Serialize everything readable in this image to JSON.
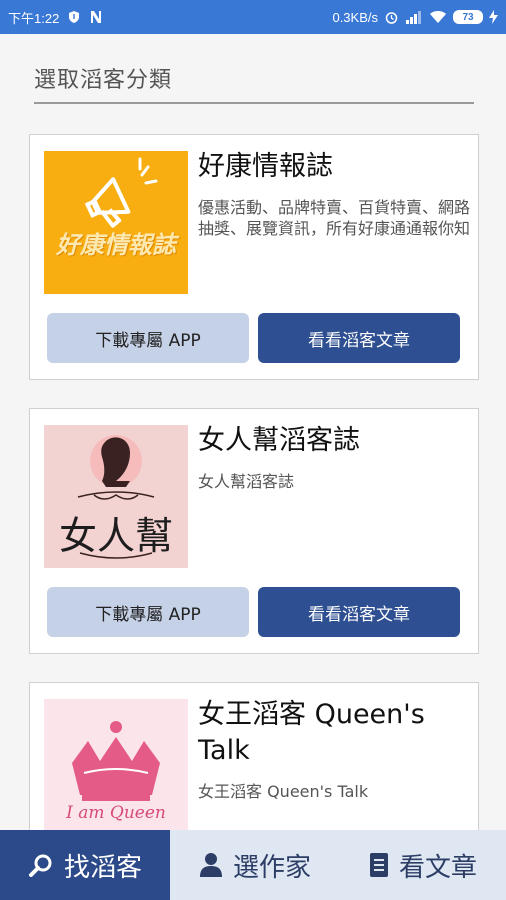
{
  "status_bar": {
    "time": "下午1:22",
    "speed": "0.3KB/s",
    "battery": "73"
  },
  "header": {
    "title": "選取滔客分類"
  },
  "cards": [
    {
      "title": "好康情報誌",
      "description": "優惠活動、品牌特賣、百貨特賣、網路抽獎、展覽資訊，所有好康通通報你知",
      "thumb_text": "好康情報誌",
      "download_label": "下載專屬 APP",
      "articles_label": "看看滔客文章"
    },
    {
      "title": "女人幫滔客誌",
      "description": "女人幫滔客誌",
      "thumb_text": "女人幫",
      "download_label": "下載專屬 APP",
      "articles_label": "看看滔客文章"
    },
    {
      "title": "女王滔客 Queen's Talk",
      "description": "女王滔客 Queen's Talk",
      "thumb_text": "I am Queen"
    }
  ],
  "bottom_nav": [
    {
      "label": "找滔客",
      "icon": "search-icon"
    },
    {
      "label": "選作家",
      "icon": "person-icon"
    },
    {
      "label": "看文章",
      "icon": "document-icon"
    }
  ],
  "colors": {
    "status_bar": "#3a78d6",
    "primary_dark": "#2e4f91",
    "button_light": "#c5d1e6",
    "nav_active": "#2c4a8a",
    "nav_bg": "#dfe7f3"
  }
}
